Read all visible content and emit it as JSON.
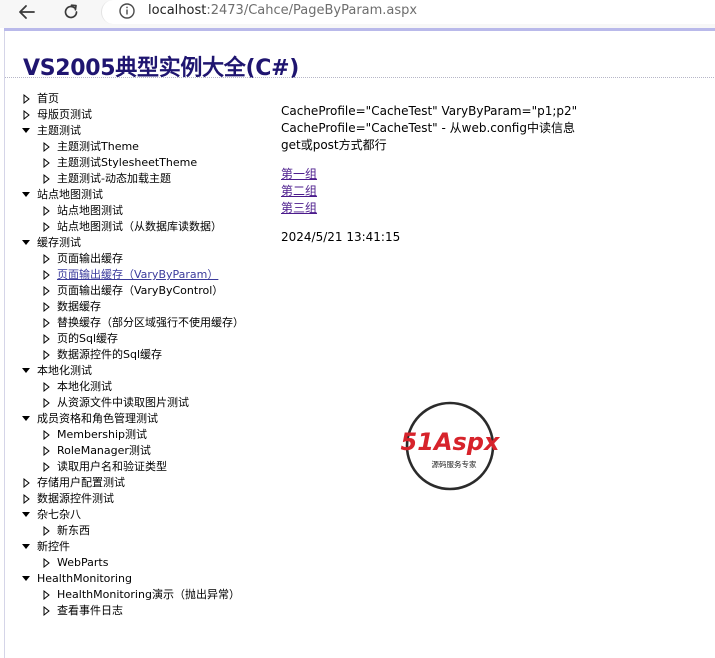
{
  "browser": {
    "url_host": "localhost",
    "url_path": ":2473/Cahce/PageByParam.aspx"
  },
  "header": {
    "title": "VS2005典型实例大全(C#)"
  },
  "tree": [
    {
      "label": "首页",
      "level": 0,
      "expanded": false
    },
    {
      "label": "母版页测试",
      "level": 0,
      "expanded": false
    },
    {
      "label": "主题测试",
      "level": 0,
      "expanded": true
    },
    {
      "label": "主题测试Theme",
      "level": 1,
      "expanded": false
    },
    {
      "label": "主题测试StylesheetTheme",
      "level": 1,
      "expanded": false
    },
    {
      "label": "主题测试-动态加载主题",
      "level": 1,
      "expanded": false
    },
    {
      "label": "站点地图测试",
      "level": 0,
      "expanded": true
    },
    {
      "label": "站点地图测试",
      "level": 1,
      "expanded": false
    },
    {
      "label": "站点地图测试（从数据库读数据）",
      "level": 1,
      "expanded": false
    },
    {
      "label": "缓存测试",
      "level": 0,
      "expanded": true
    },
    {
      "label": "页面输出缓存",
      "level": 1,
      "expanded": false
    },
    {
      "label": "页面输出缓存（VaryByParam）",
      "level": 1,
      "expanded": false,
      "current": true
    },
    {
      "label": "页面输出缓存（VaryByControl）",
      "level": 1,
      "expanded": false
    },
    {
      "label": "数据缓存",
      "level": 1,
      "expanded": false
    },
    {
      "label": "替换缓存（部分区域强行不使用缓存）",
      "level": 1,
      "expanded": false
    },
    {
      "label": "页的Sql缓存",
      "level": 1,
      "expanded": false
    },
    {
      "label": "数据源控件的Sql缓存",
      "level": 1,
      "expanded": false
    },
    {
      "label": "本地化测试",
      "level": 0,
      "expanded": true
    },
    {
      "label": "本地化测试",
      "level": 1,
      "expanded": false
    },
    {
      "label": "从资源文件中读取图片测试",
      "level": 1,
      "expanded": false
    },
    {
      "label": "成员资格和角色管理测试",
      "level": 0,
      "expanded": true
    },
    {
      "label": "Membership测试",
      "level": 1,
      "expanded": false
    },
    {
      "label": "RoleManager测试",
      "level": 1,
      "expanded": false
    },
    {
      "label": "读取用户名和验证类型",
      "level": 1,
      "expanded": false
    },
    {
      "label": "存储用户配置测试",
      "level": 0,
      "expanded": false
    },
    {
      "label": "数据源控件测试",
      "level": 0,
      "expanded": false
    },
    {
      "label": "杂七杂八",
      "level": 0,
      "expanded": true
    },
    {
      "label": "新东西",
      "level": 1,
      "expanded": false
    },
    {
      "label": "新控件",
      "level": 0,
      "expanded": true
    },
    {
      "label": "WebParts",
      "level": 1,
      "expanded": false
    },
    {
      "label": "HealthMonitoring",
      "level": 0,
      "expanded": true
    },
    {
      "label": "HealthMonitoring演示（抛出异常）",
      "level": 1,
      "expanded": false
    },
    {
      "label": "查看事件日志",
      "level": 1,
      "expanded": false
    }
  ],
  "content": {
    "line1": "CacheProfile=\"CacheTest\" VaryByParam=\"p1;p2\"",
    "line2": "CacheProfile=\"CacheTest\" - 从web.config中读信息",
    "line3": "get或post方式都行",
    "links": [
      "第一组",
      "第二组",
      "第三组"
    ],
    "timestamp": "2024/5/21 13:41:15"
  },
  "logo": {
    "brand": "51Aspx",
    "tagline": "源码服务专家",
    "brand_red": "#d7232b",
    "brand_green": "#3f9b35"
  },
  "colors": {
    "title": "#1f1570",
    "link": "#4b1b8c"
  }
}
